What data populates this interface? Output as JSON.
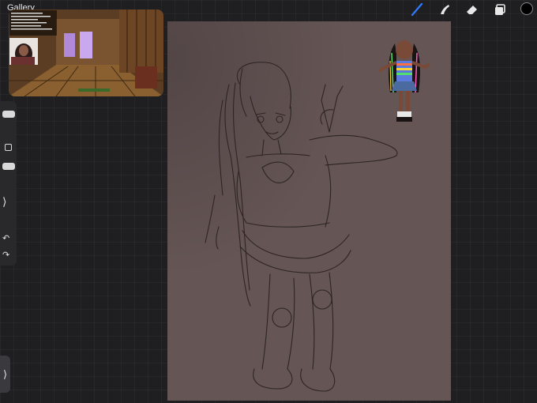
{
  "topbar": {
    "gallery_label": "Gallery",
    "tools": [
      {
        "icon": "brush-icon",
        "active": true,
        "color": "#2f7dff"
      },
      {
        "icon": "smudge-icon",
        "active": false
      },
      {
        "icon": "eraser-icon",
        "active": false
      },
      {
        "icon": "layers-icon",
        "active": false
      }
    ],
    "current_color": "#000000"
  },
  "sidebar": {
    "brush_size_slider": "slider-handle",
    "opacity_slider": "slider-handle",
    "modify_icon": "square-icon",
    "expand_glyph": "⟩",
    "undo_glyph": "↶",
    "redo_glyph": "↷"
  },
  "bottom_tab": {
    "glyph": "⟩"
  },
  "canvas": {
    "background": "#655555",
    "line_color": "#2d2424"
  },
  "reference": {
    "content": "video-game-stream-overlay"
  }
}
